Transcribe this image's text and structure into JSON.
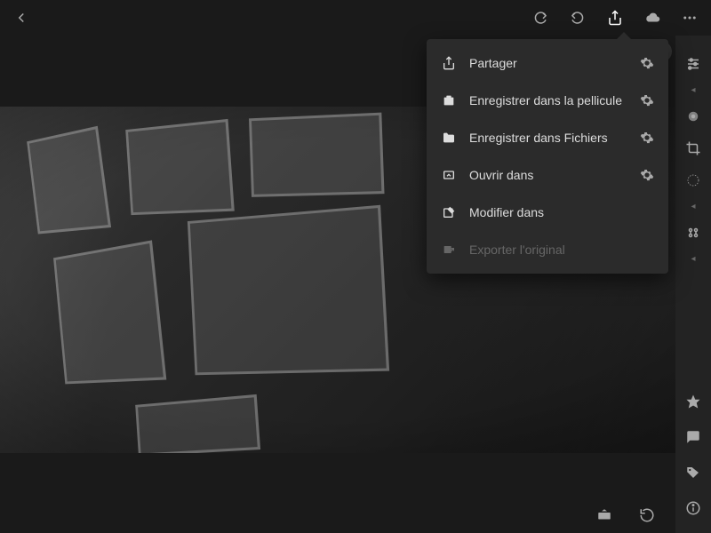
{
  "menu": {
    "items": [
      {
        "label": "Partager",
        "has_gear": true,
        "disabled": false
      },
      {
        "label": "Enregistrer dans la pellicule",
        "has_gear": true,
        "disabled": false
      },
      {
        "label": "Enregistrer dans Fichiers",
        "has_gear": true,
        "disabled": false
      },
      {
        "label": "Ouvrir dans",
        "has_gear": true,
        "disabled": false
      },
      {
        "label": "Modifier dans",
        "has_gear": false,
        "disabled": false
      },
      {
        "label": "Exporter l'original",
        "has_gear": false,
        "disabled": true
      }
    ]
  }
}
